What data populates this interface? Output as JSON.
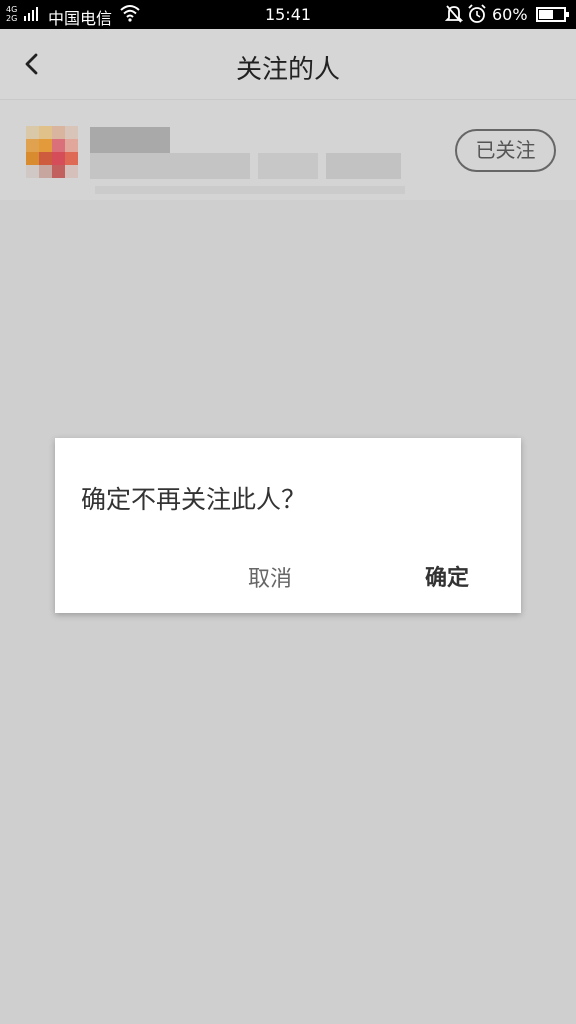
{
  "status_bar": {
    "network": "4G 2G",
    "carrier": "中国电信",
    "time": "15:41",
    "battery_percent": "60%",
    "battery_level": 0.6,
    "icons": [
      "signal-icon",
      "wifi-icon",
      "bell-mute-icon",
      "alarm-icon",
      "battery-icon"
    ]
  },
  "header": {
    "title": "关注的人",
    "back_icon": "chevron-left-icon"
  },
  "list": {
    "items": [
      {
        "follow_label": "已关注"
      }
    ]
  },
  "dialog": {
    "message": "确定不再关注此人？",
    "cancel_label": "取消",
    "confirm_label": "确定"
  },
  "colors": {
    "overlay_background": "#cfcfcf",
    "dialog_background": "#ffffff",
    "status_bar": "#000000"
  }
}
